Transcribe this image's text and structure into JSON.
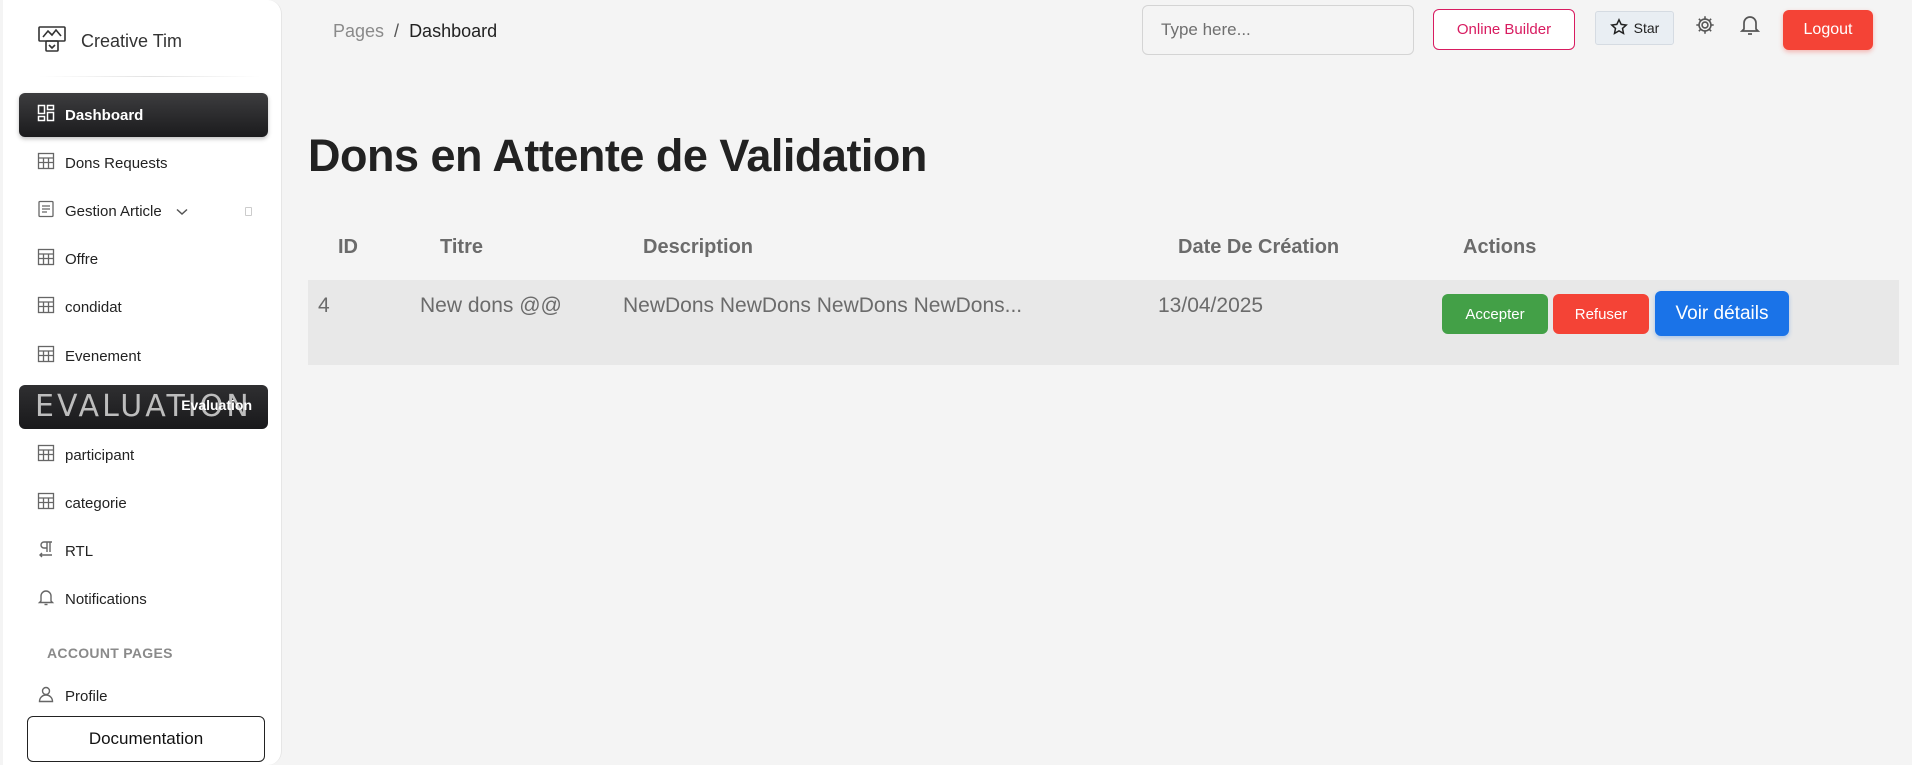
{
  "brand": {
    "name": "Creative Tim",
    "icon": "logo-icon"
  },
  "sidebar": {
    "items": [
      {
        "label": "Dashboard",
        "icon": "dashboard-icon",
        "active": true
      },
      {
        "label": "Dons Requests",
        "icon": "table-icon"
      },
      {
        "label": "Gestion Article",
        "icon": "article-icon",
        "has_dropdown": true
      },
      {
        "label": "Offre",
        "icon": "table-icon"
      },
      {
        "label": "condidat",
        "icon": "table-icon"
      },
      {
        "label": "Evenement",
        "icon": "table-icon"
      },
      {
        "label": "Evaluation",
        "watermark": "EVALUATION"
      },
      {
        "label": "participant",
        "icon": "table-icon"
      },
      {
        "label": "categorie",
        "icon": "table-icon"
      },
      {
        "label": "RTL",
        "icon": "rtl-icon"
      },
      {
        "label": "Notifications",
        "icon": "bell-icon"
      }
    ],
    "section_label": "ACCOUNT PAGES",
    "account_items": [
      {
        "label": "Profile",
        "icon": "user-icon"
      }
    ],
    "documentation_label": "Documentation"
  },
  "header": {
    "breadcrumb": {
      "parent": "Pages",
      "separator": "/",
      "current": "Dashboard"
    },
    "search_placeholder": "Type here...",
    "online_builder_label": "Online Builder",
    "star_label": "Star",
    "logout_label": "Logout"
  },
  "main": {
    "title": "Dons en Attente de Validation",
    "table": {
      "columns": [
        "ID",
        "Titre",
        "Description",
        "Date De Création",
        "Actions"
      ],
      "rows": [
        {
          "id": "4",
          "titre": "New dons @@",
          "description": "NewDons NewDons NewDons NewDons...",
          "date": "13/04/2025",
          "actions": [
            "Accepter",
            "Refuser",
            "Voir détails"
          ]
        }
      ]
    }
  },
  "colors": {
    "accept": "#43a047",
    "refuse": "#f44336",
    "view": "#1a73e8",
    "builder": "#d81b60",
    "logout": "#f44336"
  }
}
